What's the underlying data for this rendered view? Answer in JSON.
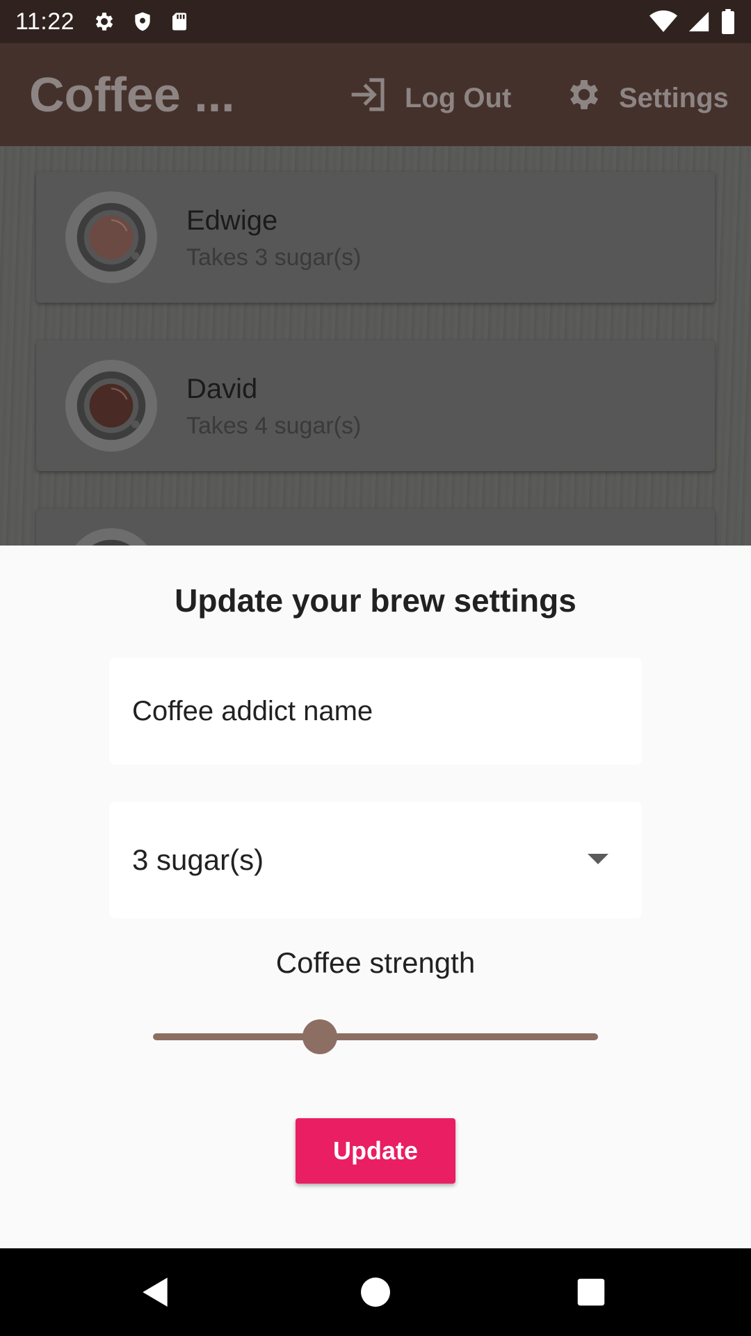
{
  "status_bar": {
    "time": "11:22"
  },
  "app_bar": {
    "title": "Coffee ...",
    "logout_label": "Log Out",
    "settings_label": "Settings"
  },
  "brew_list": [
    {
      "name": "Edwige",
      "sugar": "Takes 3 sugar(s)",
      "strength_color": "#6b4a44"
    },
    {
      "name": "David",
      "sugar": "Takes 4 sugar(s)",
      "strength_color": "#4a2a24"
    }
  ],
  "sheet": {
    "title": "Update your brew settings",
    "name_placeholder": "Coffee addict name",
    "sugar_value": "3 sugar(s)",
    "strength_label": "Coffee strength",
    "strength_fraction": 0.375,
    "update_label": "Update"
  },
  "colors": {
    "accent": "#e91e63",
    "slider": "#8d6e63",
    "app_bar": "#45312b"
  }
}
